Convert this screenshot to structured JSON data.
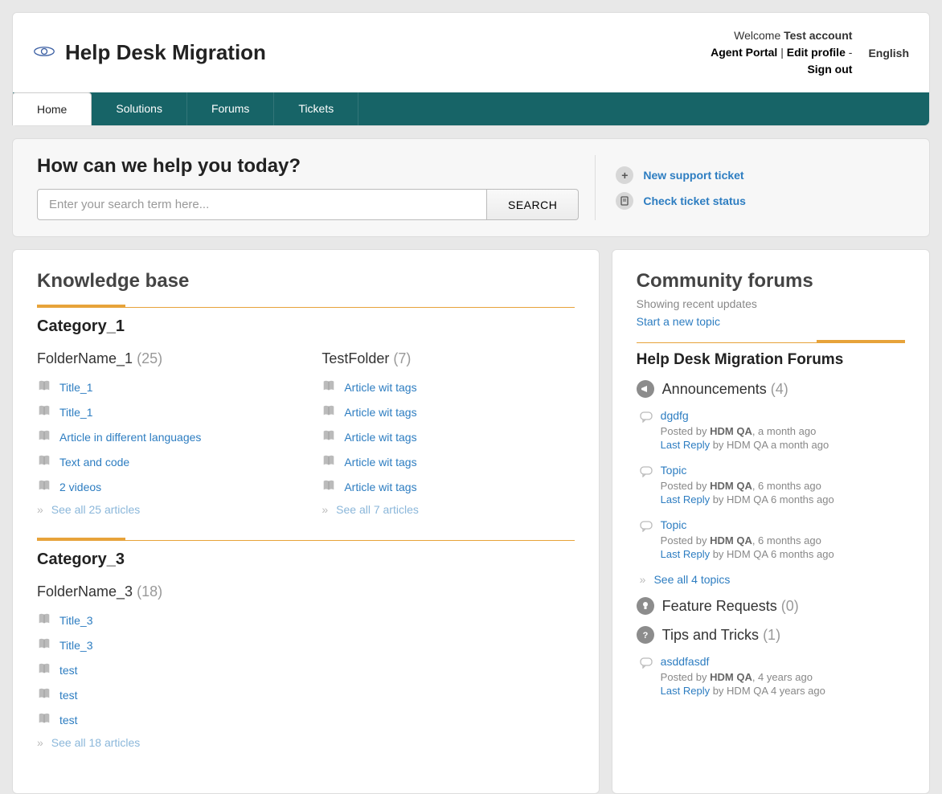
{
  "brand": {
    "title": "Help Desk Migration"
  },
  "header": {
    "welcome_prefix": "Welcome ",
    "account_name": "Test account",
    "agent_portal": "Agent Portal",
    "sep1": " | ",
    "edit_profile": "Edit profile",
    "sep2": " - ",
    "sign_out": "Sign out",
    "language": "English"
  },
  "nav": {
    "home": "Home",
    "solutions": "Solutions",
    "forums": "Forums",
    "tickets": "Tickets"
  },
  "search": {
    "title": "How can we help you today?",
    "placeholder": "Enter your search term here...",
    "button": "SEARCH"
  },
  "quick": {
    "new_ticket": "New support ticket",
    "check_status": "Check ticket status"
  },
  "kb": {
    "title": "Knowledge base",
    "categories": [
      {
        "name": "Category_1",
        "folders": [
          {
            "name": "FolderName_1",
            "count": "(25)",
            "articles": [
              "Title_1",
              "Title_1",
              "Article in different languages",
              "Text and code",
              "2 videos"
            ],
            "see_all": "See all 25 articles"
          },
          {
            "name": "TestFolder",
            "count": "(7)",
            "articles": [
              "Article wit tags",
              "Article wit tags",
              "Article wit tags",
              "Article wit tags",
              "Article wit tags"
            ],
            "see_all": "See all 7 articles"
          }
        ]
      },
      {
        "name": "Category_3",
        "folders": [
          {
            "name": "FolderName_3",
            "count": "(18)",
            "articles": [
              "Title_3",
              "Title_3",
              "test",
              "test",
              "test"
            ],
            "see_all": "See all 18 articles"
          }
        ]
      }
    ]
  },
  "community": {
    "title": "Community forums",
    "subtitle": "Showing recent updates",
    "start_topic": "Start a new topic",
    "forum_name": "Help Desk Migration Forums",
    "sections": [
      {
        "name": "Announcements",
        "count": "(4)",
        "topics": [
          {
            "title": "dgdfg",
            "posted_prefix": "Posted by ",
            "author": "HDM QA",
            "when": ", a month ago",
            "last_label": "Last Reply",
            "last_rest": " by HDM QA a month ago"
          },
          {
            "title": "Topic",
            "posted_prefix": "Posted by ",
            "author": "HDM QA",
            "when": ", 6 months ago",
            "last_label": "Last Reply",
            "last_rest": " by HDM QA 6 months ago"
          },
          {
            "title": "Topic",
            "posted_prefix": "Posted by ",
            "author": "HDM QA",
            "when": ", 6 months ago",
            "last_label": "Last Reply",
            "last_rest": " by HDM QA 6 months ago"
          }
        ],
        "see_all": "See all 4 topics"
      },
      {
        "name": "Feature Requests",
        "count": "(0)",
        "topics": []
      },
      {
        "name": "Tips and Tricks",
        "count": "(1)",
        "topics": [
          {
            "title": "asddfasdf",
            "posted_prefix": "Posted by ",
            "author": "HDM QA",
            "when": ", 4 years ago",
            "last_label": "Last Reply",
            "last_rest": " by HDM QA 4 years ago"
          }
        ]
      }
    ]
  }
}
